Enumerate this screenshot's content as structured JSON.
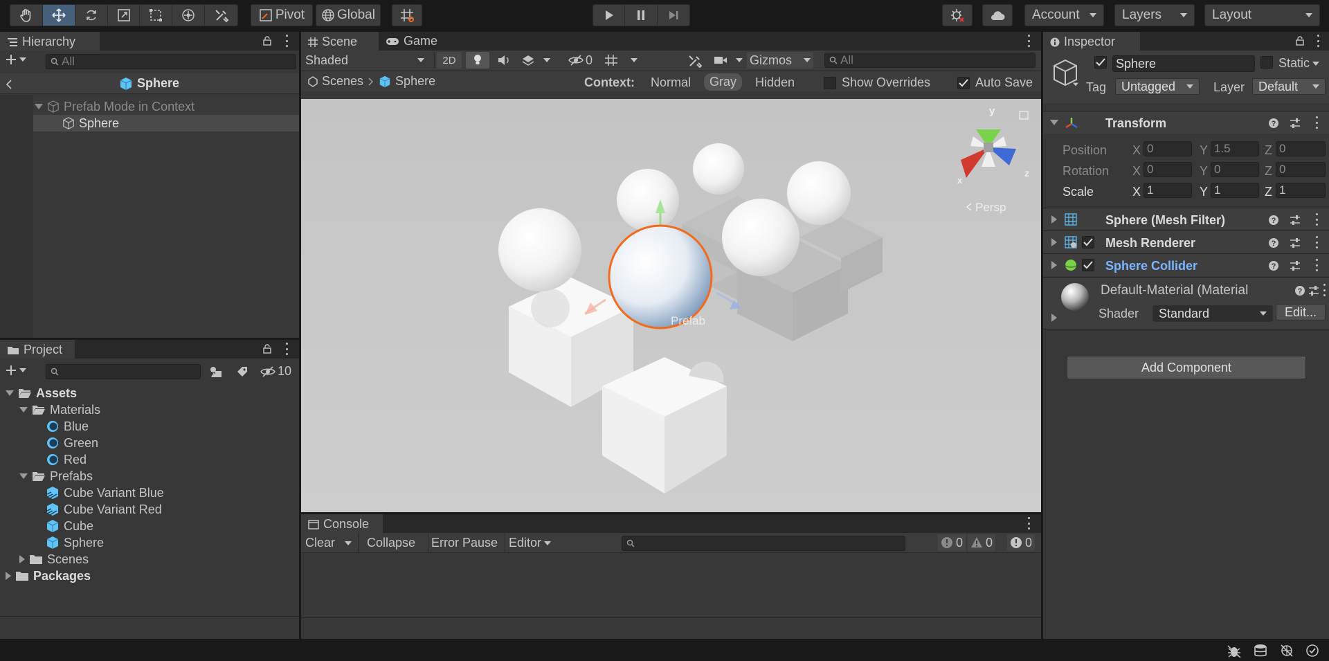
{
  "toolbar": {
    "tools": [
      "hand-tool",
      "move-tool",
      "rotate-tool",
      "scale-tool",
      "rect-tool",
      "transform-tool",
      "custom-tool"
    ],
    "pivot_label": "Pivot",
    "global_label": "Global",
    "account_label": "Account",
    "layers_label": "Layers",
    "layout_label": "Layout"
  },
  "hierarchy": {
    "tab_label": "Hierarchy",
    "search_placeholder": "All",
    "breadcrumb_title": "Sphere",
    "items": [
      {
        "label": "Prefab Mode in Context"
      },
      {
        "label": "Sphere"
      }
    ]
  },
  "scene": {
    "tab_scene": "Scene",
    "tab_game": "Game",
    "shading_mode": "Shaded",
    "mode_2d": "2D",
    "hidden_count": "0",
    "gizmos_label": "Gizmos",
    "search_placeholder": "All",
    "breadcrumb_root": "Scenes",
    "breadcrumb_current": "Sphere",
    "context_label": "Context:",
    "context_options": [
      "Normal",
      "Gray",
      "Hidden"
    ],
    "context_selected": "Gray",
    "show_overrides_label": "Show Overrides",
    "auto_save_label": "Auto Save",
    "prefab_label": "Prefab",
    "persp_label": "Persp",
    "axis_labels": {
      "x": "x",
      "y": "y",
      "z": "z"
    }
  },
  "project": {
    "tab_label": "Project",
    "hidden_packages_count": "10",
    "tree": [
      {
        "label": "Assets",
        "bold": true
      },
      {
        "label": "Materials"
      },
      {
        "label": "Blue"
      },
      {
        "label": "Green"
      },
      {
        "label": "Red"
      },
      {
        "label": "Prefabs"
      },
      {
        "label": "Cube Variant Blue"
      },
      {
        "label": "Cube Variant Red"
      },
      {
        "label": "Cube"
      },
      {
        "label": "Sphere"
      },
      {
        "label": "Scenes"
      },
      {
        "label": "Packages",
        "bold": true
      }
    ]
  },
  "console": {
    "tab_label": "Console",
    "clear_label": "Clear",
    "collapse_label": "Collapse",
    "error_pause_label": "Error Pause",
    "editor_label": "Editor",
    "log_count": "0",
    "warning_count": "0",
    "error_count": "0"
  },
  "inspector": {
    "tab_label": "Inspector",
    "object_name": "Sphere",
    "static_label": "Static",
    "tag_label": "Tag",
    "tag_value": "Untagged",
    "layer_label": "Layer",
    "layer_value": "Default",
    "transform": {
      "title": "Transform",
      "position_label": "Position",
      "rotation_label": "Rotation",
      "scale_label": "Scale",
      "position": {
        "x": "0",
        "y": "1.5",
        "z": "0"
      },
      "rotation": {
        "x": "0",
        "y": "0",
        "z": "0"
      },
      "scale": {
        "x": "1",
        "y": "1",
        "z": "1"
      },
      "axis_x": "X",
      "axis_y": "Y",
      "axis_z": "Z"
    },
    "mesh_filter_title": "Sphere (Mesh Filter)",
    "mesh_renderer_title": "Mesh Renderer",
    "sphere_collider_title": "Sphere Collider",
    "material_title": "Default-Material (Material",
    "shader_label": "Shader",
    "shader_value": "Standard",
    "edit_label": "Edit...",
    "add_component_label": "Add Component"
  },
  "colors": {
    "accent_selected": "#46607c",
    "collider_title": "#7cb6ff",
    "selection_outline": "#f26b1d",
    "prefab_icon": "#5fc3f5"
  }
}
